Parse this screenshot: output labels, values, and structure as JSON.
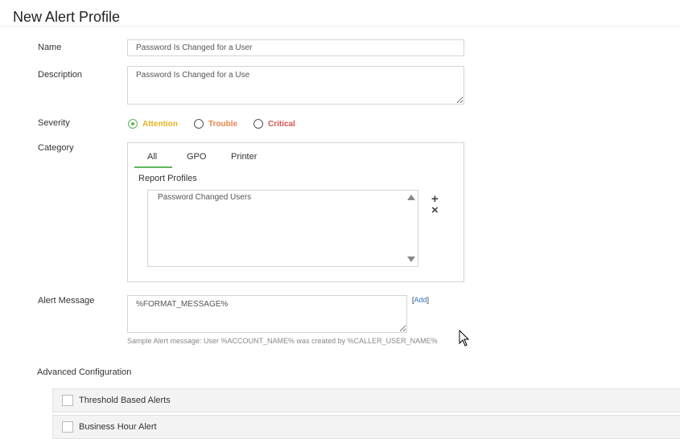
{
  "page": {
    "title": "New Alert Profile"
  },
  "form": {
    "name": {
      "label": "Name",
      "value": "Password Is Changed for a User"
    },
    "description": {
      "label": "Description",
      "value": "Password Is Changed for a Use"
    },
    "severity": {
      "label": "Severity",
      "options": [
        {
          "label": "Attention",
          "color": "#e6b422",
          "selected": true
        },
        {
          "label": "Trouble",
          "color": "#e8864a",
          "selected": false
        },
        {
          "label": "Critical",
          "color": "#d9534f",
          "selected": false
        }
      ]
    },
    "category": {
      "label": "Category",
      "tabs": [
        "All",
        "GPO",
        "Printer"
      ],
      "active_tab": "All",
      "report_profiles_label": "Report Profiles",
      "report_profiles": [
        "Password Changed Users"
      ],
      "add_icon": "+",
      "remove_icon": "×"
    },
    "alert_message": {
      "label": "Alert Message",
      "value": "%FORMAT_MESSAGE%",
      "add_link": "Add",
      "hint": "Sample Alert message: User %ACCOUNT_NAME% was created by %CALLER_USER_NAME%"
    }
  },
  "advanced": {
    "title": "Advanced Configuration",
    "options": [
      {
        "label": "Threshold Based Alerts",
        "checked": false
      },
      {
        "label": "Business Hour Alert",
        "checked": false
      }
    ]
  },
  "colors": {
    "accent": "#5cb85c",
    "link": "#2a75c4"
  }
}
